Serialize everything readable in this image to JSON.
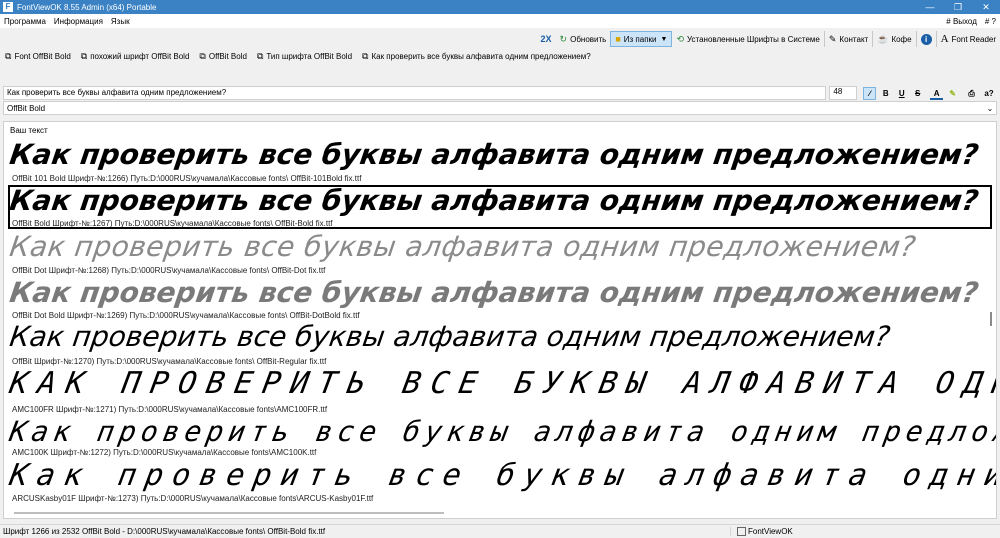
{
  "window": {
    "title": "FontViewOK 8.55 Admin (x64) Portable"
  },
  "menu": {
    "items": [
      "Программа",
      "Информация",
      "Язык"
    ],
    "right": [
      "# Выход",
      "# ?"
    ]
  },
  "toolbar1": {
    "badge": "2X",
    "refresh": "Обновить",
    "from_folder": "Из папки",
    "installed": "Установленные Шрифты в Системе",
    "contact": "Контакт",
    "coffee": "Кофе",
    "info": "i",
    "font_reader": "Font Reader"
  },
  "toolbar2": {
    "items": [
      "Font OffBit Bold",
      "похожий шрифт  OffBit Bold",
      "OffBit Bold",
      "Тип шрифта  OffBit Bold",
      "Как проверить все буквы алфавита одним предложением?"
    ]
  },
  "editor": {
    "sample_text": "Как проверить все буквы алфавита одним предложением?",
    "size": "48",
    "bold": "B",
    "underline": "U",
    "strike": "S",
    "text_color": "A",
    "case": "a?"
  },
  "font_select": {
    "value": "OffBit Bold"
  },
  "panel": {
    "label": "Ваш текст",
    "samples": [
      {
        "text": "Как проверить все буквы алфавита одним предложением?",
        "path": "OffBit 101 Bold Шрифт-№:1266) Путь:D:\\000RUS\\кучамала\\Кассовые fonts\\ OffBit-101Bold fix.ttf"
      },
      {
        "text": "Как проверить все буквы алфавита одним предложением?",
        "path": "OffBit Bold Шрифт-№:1267) Путь:D:\\000RUS\\кучамала\\Кассовые fonts\\ OffBit-Bold fix.ttf"
      },
      {
        "text": "Как проверить все буквы алфавита одним предложением?",
        "path": "OffBit Dot Шрифт-№:1268) Путь:D:\\000RUS\\кучамала\\Кассовые fonts\\ OffBit-Dot fix.ttf"
      },
      {
        "text": "Как проверить все буквы алфавита одним предложением?",
        "path": "OffBit Dot Bold Шрифт-№:1269) Путь:D:\\000RUS\\кучамала\\Кассовые fonts\\ OffBit-DotBold fix.ttf"
      },
      {
        "text": "Как проверить все буквы алфавита одним предложением?",
        "path": "OffBit Шрифт-№:1270) Путь:D:\\000RUS\\кучамала\\Кассовые fonts\\ OffBit-Regular fix.ttf"
      },
      {
        "text": "КАК ПРОВЕРИТЬ ВСЕ БУКВЫ АЛФАВИТА ОДНИ",
        "path": "AMC100FR Шрифт-№:1271) Путь:D:\\000RUS\\кучамала\\Кассовые fonts\\AMC100FR.ttf"
      },
      {
        "text": "Как проверить все буквы алфавита одним предлож",
        "path": "AMC100K Шрифт-№:1272) Путь:D:\\000RUS\\кучамала\\Кассовые fonts\\AMC100K.ttf"
      },
      {
        "text": "Как проверить все буквы алфавита одни",
        "path": "ARCUSKasby01F Шрифт-№:1273) Путь:D:\\000RUS\\кучамала\\Кассовые fonts\\ARCUS-Kasby01F.ttf"
      }
    ]
  },
  "status": {
    "left": "Шрифт 1266 из 2532 OffBit Bold - D:\\000RUS\\кучамала\\Кассовые fonts\\ OffBit-Bold fix.ttf",
    "right": "FontViewOK"
  },
  "colors": {
    "titlebar": "#3a82c4",
    "accent": "#1a5ea8",
    "selection": "#cce4f7"
  }
}
